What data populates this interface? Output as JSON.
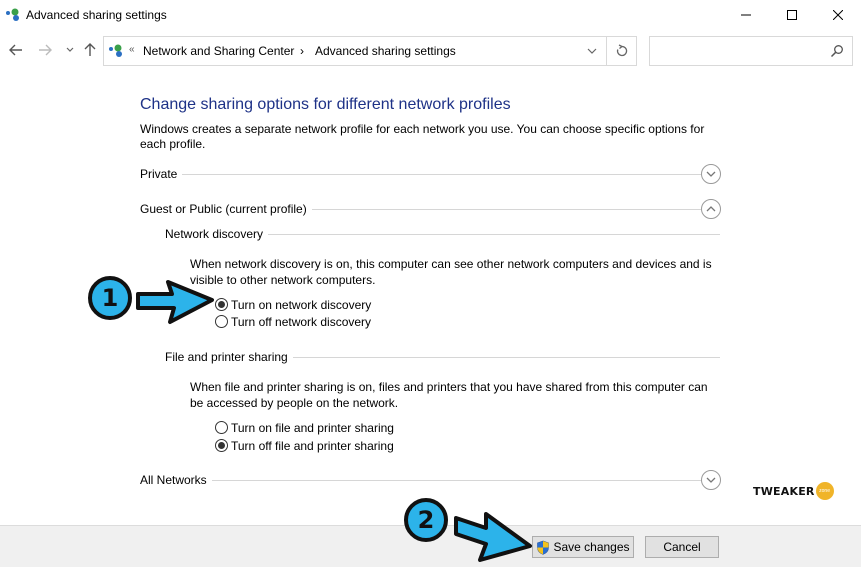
{
  "window": {
    "title": "Advanced sharing settings",
    "controls": {
      "minimize": "minimize",
      "maximize": "maximize",
      "close": "close"
    }
  },
  "navigation": {
    "overflow_chevron": "«",
    "breadcrumb": [
      "Network and Sharing Center",
      "Advanced sharing settings"
    ],
    "separator": "›",
    "search_placeholder": ""
  },
  "content": {
    "heading": "Change sharing options for different network profiles",
    "intro": "Windows creates a separate network profile for each network you use. You can choose specific options for each profile.",
    "profiles": [
      {
        "label": "Private",
        "expanded": false
      },
      {
        "label": "Guest or Public (current profile)",
        "expanded": true
      },
      {
        "label": "All Networks",
        "expanded": false
      }
    ],
    "network_discovery": {
      "label": "Network discovery",
      "description": "When network discovery is on, this computer can see other network computers and devices and is visible to other network computers.",
      "options": [
        {
          "label": "Turn on network discovery",
          "selected": true
        },
        {
          "label": "Turn off network discovery",
          "selected": false
        }
      ]
    },
    "file_printer_sharing": {
      "label": "File and printer sharing",
      "description": "When file and printer sharing is on, files and printers that you have shared from this computer can be accessed by people on the network.",
      "options": [
        {
          "label": "Turn on file and printer sharing",
          "selected": false
        },
        {
          "label": "Turn off file and printer sharing",
          "selected": true
        }
      ]
    }
  },
  "footer": {
    "save_label": "Save changes",
    "cancel_label": "Cancel"
  },
  "annotations": {
    "step1": "1",
    "step2": "2",
    "arrow_color": "#2cb3ea"
  },
  "watermark": {
    "text": "TWEAKER",
    "badge": "zone"
  },
  "colors": {
    "heading": "#1e3287",
    "footer_bg": "#f0f0f0",
    "button_bg": "#e1e1e1"
  }
}
